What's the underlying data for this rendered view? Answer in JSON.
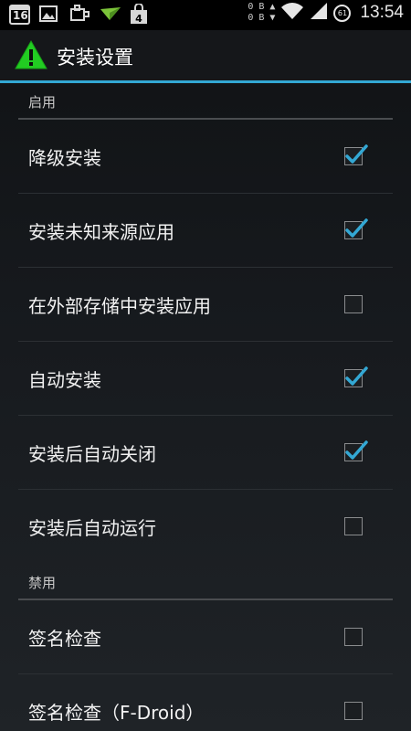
{
  "status_bar": {
    "calendar_day": "16",
    "traffic_up": "0 B",
    "traffic_down": "0 B",
    "battery_level": "61",
    "time": "13:54",
    "icons": [
      "calendar-icon",
      "image-icon",
      "plugin-icon",
      "airdroid-icon",
      "store-notification-icon",
      "wifi-icon",
      "signal-icon",
      "battery-icon"
    ],
    "store_badge": "4"
  },
  "action_bar": {
    "title": "安装设置",
    "app_icon": "warning-triangle-icon",
    "accent_color": "#33a8d4",
    "icon_color": "#22cc22"
  },
  "sections": [
    {
      "header": "启用",
      "items": [
        {
          "label": "降级安装",
          "checked": true
        },
        {
          "label": "安装未知来源应用",
          "checked": true
        },
        {
          "label": "在外部存储中安装应用",
          "checked": false
        },
        {
          "label": "自动安装",
          "checked": true
        },
        {
          "label": "安装后自动关闭",
          "checked": true
        },
        {
          "label": "安装后自动运行",
          "checked": false
        }
      ]
    },
    {
      "header": "禁用",
      "items": [
        {
          "label": "签名检查",
          "checked": false
        },
        {
          "label": "签名检查（F-Droid）",
          "checked": false
        }
      ]
    }
  ]
}
